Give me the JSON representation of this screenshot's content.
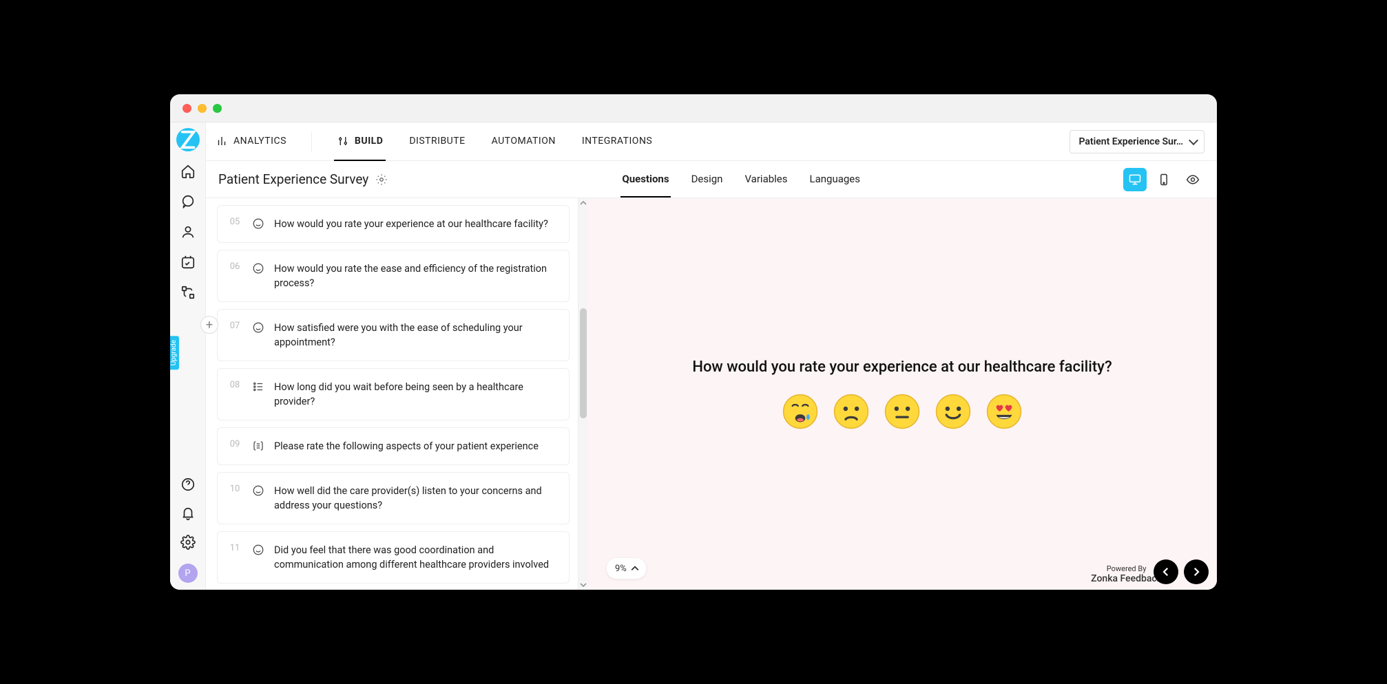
{
  "topnav": {
    "items": [
      {
        "label": "ANALYTICS"
      },
      {
        "label": "BUILD"
      },
      {
        "label": "DISTRIBUTE"
      },
      {
        "label": "AUTOMATION"
      },
      {
        "label": "INTEGRATIONS"
      }
    ],
    "survey_selector": "Patient Experience Sur…"
  },
  "survey": {
    "title": "Patient Experience Survey"
  },
  "subtabs": {
    "items": [
      {
        "label": "Questions"
      },
      {
        "label": "Design"
      },
      {
        "label": "Variables"
      },
      {
        "label": "Languages"
      }
    ]
  },
  "questions": [
    {
      "num": "05",
      "icon": "smiley",
      "text": "How would you rate your experience at our healthcare facility?"
    },
    {
      "num": "06",
      "icon": "smiley",
      "text": "How would you rate the ease and efficiency of the registration process?"
    },
    {
      "num": "07",
      "icon": "smiley",
      "text": "How satisfied were you with the ease of scheduling your appointment?"
    },
    {
      "num": "08",
      "icon": "list",
      "text": "How long did you wait before being seen by a healthcare provider?"
    },
    {
      "num": "09",
      "icon": "matrix",
      "text": "Please rate the following aspects of your patient experience"
    },
    {
      "num": "10",
      "icon": "smiley",
      "text": "How well did the care provider(s) listen to your concerns and address your questions?"
    },
    {
      "num": "11",
      "icon": "smiley",
      "text": "Did you feel that there was good coordination and communication among different healthcare providers involved"
    }
  ],
  "preview": {
    "question": "How would you rate your experience at our healthcare facility?",
    "progress": "9%",
    "powered_label": "Powered By",
    "powered_brand": "Zonka Feedback",
    "ratings": [
      {
        "name": "crying"
      },
      {
        "name": "sad"
      },
      {
        "name": "neutral"
      },
      {
        "name": "happy"
      },
      {
        "name": "love"
      }
    ]
  },
  "rail": {
    "upgrade": "Upgrade",
    "avatar": "P"
  }
}
